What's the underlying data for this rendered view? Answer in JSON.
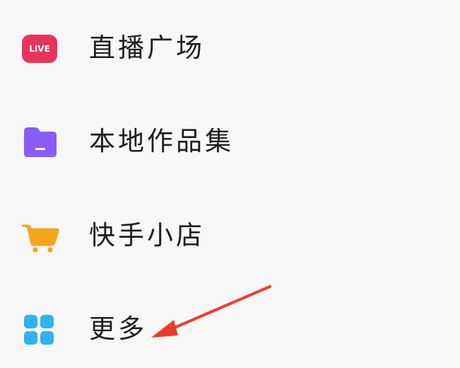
{
  "menu": {
    "items": [
      {
        "label": "直播广场",
        "icon": "live-icon",
        "icon_text": "LIVE",
        "icon_color": "#e8345a"
      },
      {
        "label": "本地作品集",
        "icon": "folder-icon",
        "icon_color": "#8b5cf6"
      },
      {
        "label": "快手小店",
        "icon": "shopping-cart-icon",
        "icon_color": "#f7a51c"
      },
      {
        "label": "更多",
        "icon": "grid-icon",
        "icon_color": "#2db4f0"
      }
    ]
  },
  "annotation": {
    "type": "arrow",
    "color": "#f03a2e",
    "points_to": "更多"
  },
  "background": "#f7f7f7"
}
